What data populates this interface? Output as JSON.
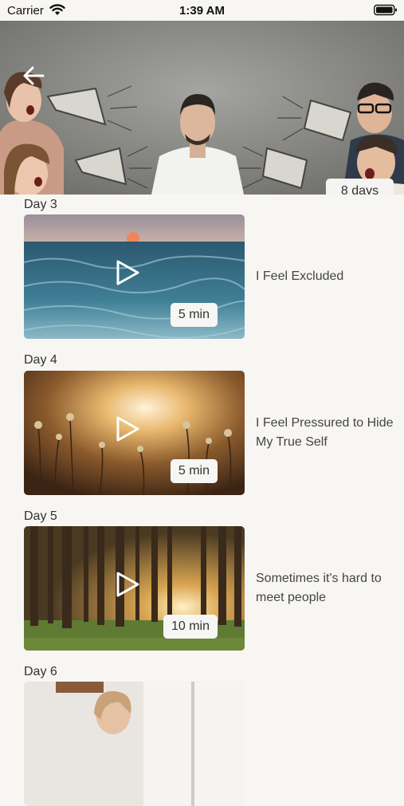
{
  "status_bar": {
    "carrier": "Carrier",
    "time": "1:39 AM"
  },
  "hero": {
    "duration": "8 days"
  },
  "items": [
    {
      "day": "Day 3",
      "duration": "5 min",
      "title": "I Feel Excluded",
      "image": "ocean-sunset"
    },
    {
      "day": "Day 4",
      "duration": "5 min",
      "title": "I Feel Pressured to Hide My True Self",
      "image": "golden-flowers"
    },
    {
      "day": "Day 5",
      "duration": "10 min",
      "title": "Sometimes it's hard to meet people",
      "image": "forest-sunrise"
    },
    {
      "day": "Day 6",
      "image": "woman-window"
    }
  ]
}
